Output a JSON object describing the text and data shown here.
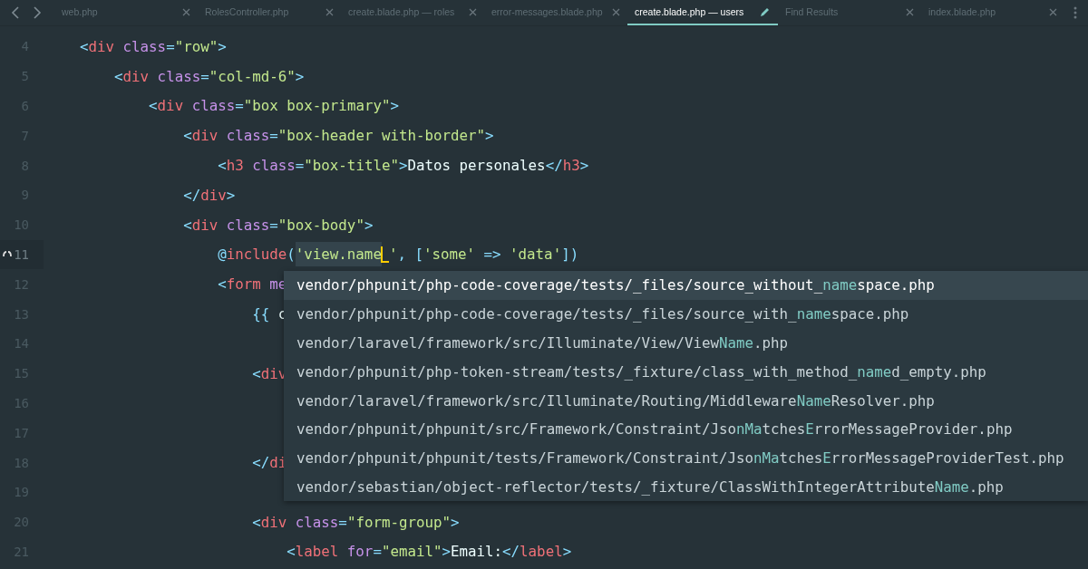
{
  "tabs": [
    {
      "label": "web.php",
      "selected": false,
      "modified": false
    },
    {
      "label": "RolesController.php",
      "selected": false,
      "modified": false
    },
    {
      "label": "create.blade.php — roles",
      "selected": false,
      "modified": false
    },
    {
      "label": "error-messages.blade.php",
      "selected": false,
      "modified": false
    },
    {
      "label": "create.blade.php — users",
      "selected": true,
      "modified": true
    },
    {
      "label": "Find Results",
      "selected": false,
      "modified": false
    },
    {
      "label": "index.blade.php",
      "selected": false,
      "modified": false
    }
  ],
  "lines": [
    {
      "number": "4",
      "current": false,
      "tokens": [
        {
          "kind": "punct",
          "text": "<"
        },
        {
          "kind": "tag",
          "text": "div"
        },
        {
          "kind": "attr",
          "text": " class"
        },
        {
          "kind": "punct",
          "text": "="
        },
        {
          "kind": "string",
          "text": "\"row\""
        },
        {
          "kind": "punct",
          "text": ">"
        }
      ]
    },
    {
      "number": "5",
      "current": false,
      "tokens": [
        {
          "kind": "punct",
          "text": "    <"
        },
        {
          "kind": "tag",
          "text": "div"
        },
        {
          "kind": "attr",
          "text": " class"
        },
        {
          "kind": "punct",
          "text": "="
        },
        {
          "kind": "string",
          "text": "\"col-md-6\""
        },
        {
          "kind": "punct",
          "text": ">"
        }
      ]
    },
    {
      "number": "6",
      "current": false,
      "tokens": [
        {
          "kind": "punct",
          "text": "        <"
        },
        {
          "kind": "tag",
          "text": "div"
        },
        {
          "kind": "attr",
          "text": " class"
        },
        {
          "kind": "punct",
          "text": "="
        },
        {
          "kind": "string",
          "text": "\"box box-primary\""
        },
        {
          "kind": "punct",
          "text": ">"
        }
      ]
    },
    {
      "number": "7",
      "current": false,
      "tokens": [
        {
          "kind": "punct",
          "text": "            <"
        },
        {
          "kind": "tag",
          "text": "div"
        },
        {
          "kind": "attr",
          "text": " class"
        },
        {
          "kind": "punct",
          "text": "="
        },
        {
          "kind": "string",
          "text": "\"box-header with-border\""
        },
        {
          "kind": "punct",
          "text": ">"
        }
      ]
    },
    {
      "number": "8",
      "current": false,
      "tokens": [
        {
          "kind": "punct",
          "text": "                <"
        },
        {
          "kind": "tag",
          "text": "h3"
        },
        {
          "kind": "attr",
          "text": " class"
        },
        {
          "kind": "punct",
          "text": "="
        },
        {
          "kind": "string",
          "text": "\"box-title\""
        },
        {
          "kind": "punct",
          "text": ">"
        },
        {
          "kind": "text",
          "text": "Datos personales"
        },
        {
          "kind": "punct",
          "text": "</"
        },
        {
          "kind": "tag",
          "text": "h3"
        },
        {
          "kind": "punct",
          "text": ">"
        }
      ]
    },
    {
      "number": "9",
      "current": false,
      "tokens": [
        {
          "kind": "punct",
          "text": "            </"
        },
        {
          "kind": "tag",
          "text": "div"
        },
        {
          "kind": "punct",
          "text": ">"
        }
      ]
    },
    {
      "number": "10",
      "current": false,
      "tokens": [
        {
          "kind": "punct",
          "text": "            <"
        },
        {
          "kind": "tag",
          "text": "div"
        },
        {
          "kind": "attr",
          "text": " class"
        },
        {
          "kind": "punct",
          "text": "="
        },
        {
          "kind": "string",
          "text": "\"box-body\""
        },
        {
          "kind": "punct",
          "text": ">"
        }
      ]
    },
    {
      "number": "11",
      "current": true,
      "tokens": [
        {
          "kind": "punct",
          "text": "                @"
        },
        {
          "kind": "tag",
          "text": "include"
        },
        {
          "kind": "punct",
          "text": "("
        },
        {
          "kind": "match",
          "text": "'view.name"
        },
        {
          "kind": "cursor"
        },
        {
          "kind": "string",
          "text": "'"
        },
        {
          "kind": "punct",
          "text": ", ["
        },
        {
          "kind": "string",
          "text": "'some'"
        },
        {
          "kind": "punct",
          "text": " => "
        },
        {
          "kind": "string",
          "text": "'data'"
        },
        {
          "kind": "punct",
          "text": "])"
        }
      ]
    },
    {
      "number": "12",
      "current": false,
      "tokens": [
        {
          "kind": "punct",
          "text": "                <"
        },
        {
          "kind": "tag",
          "text": "form"
        },
        {
          "kind": "attr",
          "text": " me"
        }
      ]
    },
    {
      "number": "13",
      "current": false,
      "tokens": [
        {
          "kind": "punct",
          "text": "                    {{ "
        },
        {
          "kind": "text",
          "text": "c"
        }
      ]
    },
    {
      "number": "14",
      "current": false
    },
    {
      "number": "15",
      "current": false,
      "tokens": [
        {
          "kind": "punct",
          "text": "                    <"
        },
        {
          "kind": "tag",
          "text": "div"
        }
      ]
    },
    {
      "number": "16",
      "current": false
    },
    {
      "number": "17",
      "current": false
    },
    {
      "number": "18",
      "current": false,
      "tokens": [
        {
          "kind": "punct",
          "text": "                    </"
        },
        {
          "kind": "tag",
          "text": "di"
        }
      ]
    },
    {
      "number": "19",
      "current": false
    },
    {
      "number": "20",
      "current": false,
      "tokens": [
        {
          "kind": "punct",
          "text": "                    <"
        },
        {
          "kind": "tag",
          "text": "div"
        },
        {
          "kind": "attr",
          "text": " class"
        },
        {
          "kind": "punct",
          "text": "="
        },
        {
          "kind": "string",
          "text": "\"form-group\""
        },
        {
          "kind": "punct",
          "text": ">"
        }
      ]
    },
    {
      "number": "21",
      "current": false,
      "tokens": [
        {
          "kind": "punct",
          "text": "                        <"
        },
        {
          "kind": "tag",
          "text": "label"
        },
        {
          "kind": "attr",
          "text": " for"
        },
        {
          "kind": "punct",
          "text": "="
        },
        {
          "kind": "string",
          "text": "\"email\""
        },
        {
          "kind": "punct",
          "text": ">"
        },
        {
          "kind": "text",
          "text": "Email:"
        },
        {
          "kind": "punct",
          "text": "</"
        },
        {
          "kind": "tag",
          "text": "label"
        },
        {
          "kind": "punct",
          "text": ">"
        }
      ]
    }
  ],
  "suggestions": [
    {
      "selected": true,
      "parts": [
        {
          "text": "vendor/phpunit/php-code-coverage/tests/_files/source_without_",
          "match": false
        },
        {
          "text": "name",
          "match": true
        },
        {
          "text": "space.php",
          "match": false
        }
      ]
    },
    {
      "selected": false,
      "parts": [
        {
          "text": "vendor/phpunit/php-code-coverage/tests/_files/source_with_",
          "match": false
        },
        {
          "text": "name",
          "match": true
        },
        {
          "text": "space.php",
          "match": false
        }
      ]
    },
    {
      "selected": false,
      "parts": [
        {
          "text": "vendor/laravel/framework/src/Illuminate/View/View",
          "match": false
        },
        {
          "text": "Name",
          "match": true
        },
        {
          "text": ".php",
          "match": false
        }
      ]
    },
    {
      "selected": false,
      "parts": [
        {
          "text": "vendor/phpunit/php-token-stream/tests/_fixture/class_with_method_",
          "match": false
        },
        {
          "text": "name",
          "match": true
        },
        {
          "text": "d_empty.php",
          "match": false
        }
      ]
    },
    {
      "selected": false,
      "parts": [
        {
          "text": "vendor/laravel/framework/src/Illuminate/Routing/Middleware",
          "match": false
        },
        {
          "text": "Name",
          "match": true
        },
        {
          "text": "Resolver.php",
          "match": false
        }
      ]
    },
    {
      "selected": false,
      "parts": [
        {
          "text": "vendor/phpunit/phpunit/src/Framework/Constraint/Jso",
          "match": false
        },
        {
          "text": "nMa",
          "match": true
        },
        {
          "text": "tches",
          "match": false
        },
        {
          "text": "E",
          "match": true
        },
        {
          "text": "rrorMessageProvider.php",
          "match": false
        }
      ]
    },
    {
      "selected": false,
      "parts": [
        {
          "text": "vendor/phpunit/phpunit/tests/Framework/Constraint/Jso",
          "match": false
        },
        {
          "text": "nMa",
          "match": true
        },
        {
          "text": "tches",
          "match": false
        },
        {
          "text": "E",
          "match": true
        },
        {
          "text": "rrorMessageProviderTest.php",
          "match": false
        }
      ]
    },
    {
      "selected": false,
      "parts": [
        {
          "text": "vendor/sebastian/object-reflector/tests/_fixture/ClassWithIntegerAttribute",
          "match": false
        },
        {
          "text": "Name",
          "match": true
        },
        {
          "text": ".php",
          "match": false
        }
      ]
    }
  ]
}
